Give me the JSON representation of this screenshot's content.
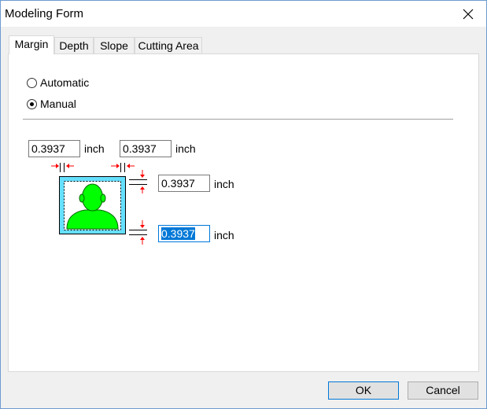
{
  "window": {
    "title": "Modeling Form"
  },
  "tabs": [
    {
      "label": "Margin",
      "active": true
    },
    {
      "label": "Depth",
      "active": false
    },
    {
      "label": "Slope",
      "active": false
    },
    {
      "label": "Cutting Area",
      "active": false
    }
  ],
  "mode": {
    "automatic_label": "Automatic",
    "manual_label": "Manual",
    "selected": "Manual"
  },
  "margins": {
    "left": {
      "value": "0.3937",
      "unit": "inch"
    },
    "right": {
      "value": "0.3937",
      "unit": "inch"
    },
    "top": {
      "value": "0.3937",
      "unit": "inch"
    },
    "bottom": {
      "value": "0.3937",
      "unit": "inch"
    }
  },
  "buttons": {
    "ok": "OK",
    "cancel": "Cancel"
  },
  "colors": {
    "accent": "#0078d7",
    "figure": "#00ff00",
    "frame": "#66e0ff",
    "arrow": "#ff0000"
  },
  "icons": {
    "close": "close-icon",
    "preview": "person-silhouette-icon"
  }
}
